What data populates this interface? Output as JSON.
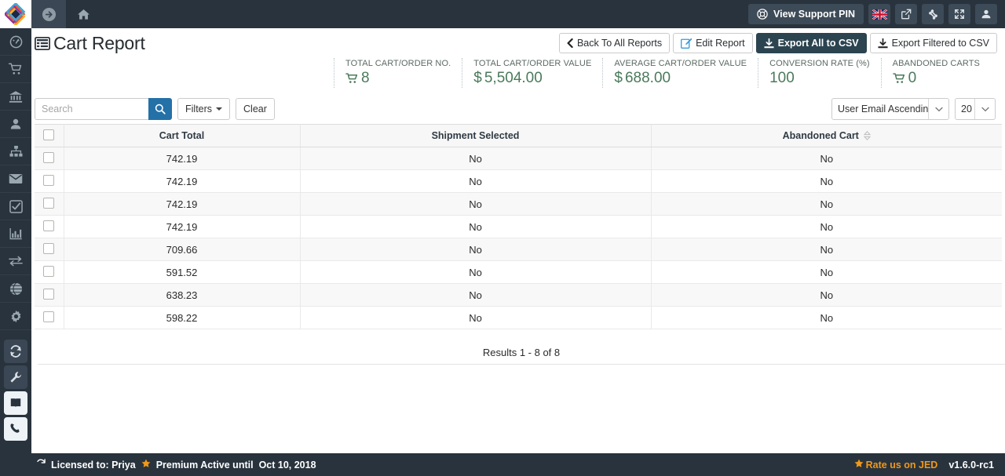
{
  "topbar": {
    "logo_icon": "diamond-logo-icon",
    "forward_icon": "arrow-circle-right-icon",
    "home_icon": "home-icon",
    "support_pin_label": "View Support PIN",
    "support_pin_icon": "life-ring-icon",
    "flag_icon": "uk-flag-icon",
    "external_link_icon": "external-link-icon",
    "joomla_icon": "joomla-icon",
    "expand_icon": "expand-arrows-icon",
    "user_icon": "user-icon"
  },
  "sidebar": {
    "items": [
      {
        "icon": "dashboard-gauge-icon",
        "name": "dashboard"
      },
      {
        "icon": "shopping-cart-icon",
        "name": "orders"
      },
      {
        "icon": "bank-icon",
        "name": "payments"
      },
      {
        "icon": "user-icon",
        "name": "customers"
      },
      {
        "icon": "sitemap-icon",
        "name": "categories"
      },
      {
        "icon": "envelope-icon",
        "name": "messages"
      },
      {
        "icon": "check-square-icon",
        "name": "tasks"
      },
      {
        "icon": "bar-chart-icon",
        "name": "reports"
      },
      {
        "icon": "exchange-arrows-icon",
        "name": "transactions"
      },
      {
        "icon": "globe-icon",
        "name": "languages"
      },
      {
        "icon": "gear-icon",
        "name": "settings"
      }
    ],
    "tools": [
      {
        "icon": "refresh-icon",
        "name": "update",
        "style": "tool"
      },
      {
        "icon": "wrench-icon",
        "name": "maintenance",
        "style": "tool"
      },
      {
        "icon": "book-icon",
        "name": "documentation",
        "style": "light"
      },
      {
        "icon": "phone-icon",
        "name": "support",
        "style": "light"
      }
    ]
  },
  "page": {
    "title": "Cart Report",
    "title_icon": "table-list-icon"
  },
  "actions": {
    "back": {
      "label": "Back To All Reports",
      "icon": "chevron-left-icon"
    },
    "edit": {
      "label": "Edit Report",
      "icon": "edit-pencil-icon"
    },
    "export_all": {
      "label": "Export All to CSV",
      "icon": "download-icon"
    },
    "export_filtered": {
      "label": "Export Filtered to CSV",
      "icon": "download-icon"
    }
  },
  "stats": [
    {
      "label": "TOTAL CART/ORDER NO.",
      "symbol": "cart",
      "value": "8"
    },
    {
      "label": "TOTAL CART/ORDER VALUE",
      "symbol": "$",
      "value": "5,504.00"
    },
    {
      "label": "AVERAGE CART/ORDER VALUE",
      "symbol": "$",
      "value": "688.00"
    },
    {
      "label": "CONVERSION RATE (%)",
      "symbol": "",
      "value": "100"
    },
    {
      "label": "ABANDONED CARTS",
      "symbol": "cart",
      "value": "0"
    }
  ],
  "toolbar": {
    "search_placeholder": "Search",
    "search_value": "",
    "search_icon": "magnifier-icon",
    "filters_label": "Filters",
    "clear_label": "Clear",
    "sort_selected": "User Email Ascending",
    "per_page_selected": "20"
  },
  "table": {
    "columns": [
      {
        "label": "",
        "name": "select-all",
        "sortable": false
      },
      {
        "label": "Cart Total",
        "name": "cart-total",
        "sortable": false
      },
      {
        "label": "Shipment Selected",
        "name": "shipment-selected",
        "sortable": false
      },
      {
        "label": "Abandoned Cart",
        "name": "abandoned-cart",
        "sortable": true
      }
    ],
    "rows": [
      {
        "cart_total": "742.19",
        "shipment_selected": "No",
        "abandoned_cart": "No"
      },
      {
        "cart_total": "742.19",
        "shipment_selected": "No",
        "abandoned_cart": "No"
      },
      {
        "cart_total": "742.19",
        "shipment_selected": "No",
        "abandoned_cart": "No"
      },
      {
        "cart_total": "742.19",
        "shipment_selected": "No",
        "abandoned_cart": "No"
      },
      {
        "cart_total": "709.66",
        "shipment_selected": "No",
        "abandoned_cart": "No"
      },
      {
        "cart_total": "591.52",
        "shipment_selected": "No",
        "abandoned_cart": "No"
      },
      {
        "cart_total": "638.23",
        "shipment_selected": "No",
        "abandoned_cart": "No"
      },
      {
        "cart_total": "598.22",
        "shipment_selected": "No",
        "abandoned_cart": "No"
      }
    ],
    "results_text": "Results 1 - 8 of 8"
  },
  "footer": {
    "refresh_icon": "refresh-icon",
    "licensed_to": "Licensed to: Priya",
    "star_icon": "star-icon",
    "premium_text": "Premium Active until",
    "premium_date": "Oct 10, 2018",
    "jed_label": "Rate us on JED",
    "version": "v1.6.0-rc1"
  },
  "colors": {
    "dark_chrome": "#29333d",
    "accent_dark_button": "#2b4450",
    "search_blue": "#2471a8",
    "stat_green": "#4a7a5b",
    "footer_orange": "#f0981b"
  }
}
